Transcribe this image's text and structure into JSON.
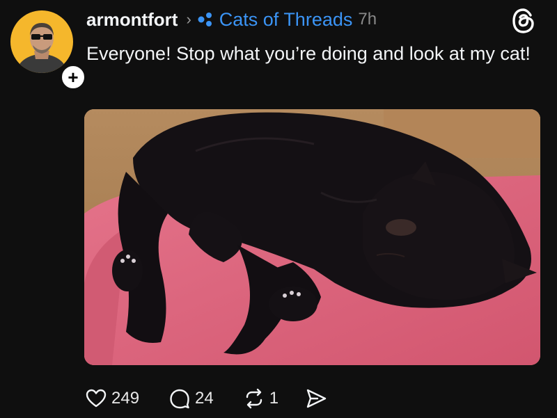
{
  "post": {
    "username": "armontfort",
    "chevron": "›",
    "community": "Cats of Threads",
    "time": "7h",
    "text": "Everyone! Stop what you’re doing and look at my cat!",
    "follow_symbol": "+"
  },
  "actions": {
    "likes": "249",
    "replies": "24",
    "reposts": "1"
  },
  "icons": {
    "avatar": "user-avatar",
    "follow": "plus-icon",
    "community": "community-icon",
    "logo": "threads-logo-icon",
    "like": "heart-icon",
    "reply": "comment-icon",
    "repost": "repost-icon",
    "share": "send-icon"
  },
  "colors": {
    "background": "#0f0f0f",
    "text": "#f3f5f7",
    "community_link": "#3b94f5",
    "muted": "#8a8a8a",
    "avatar_bg": "#f5b72c"
  }
}
